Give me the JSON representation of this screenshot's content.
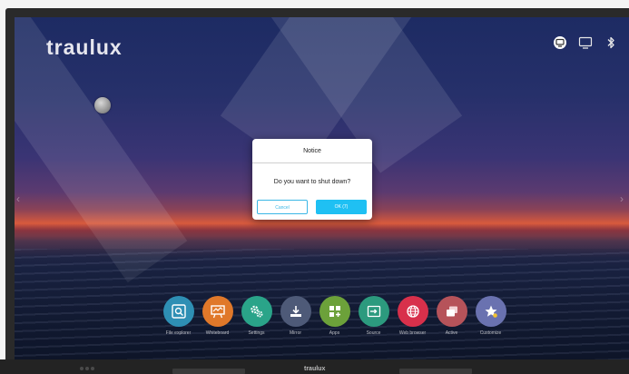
{
  "brand": {
    "logo_text": "traulux"
  },
  "tray": {
    "icons": [
      "screen-cast-icon",
      "monitor-icon",
      "bluetooth-icon"
    ]
  },
  "dialog": {
    "title": "Notice",
    "message": "Do you want to shut down?",
    "cancel_label": "Cancel",
    "ok_label": "OK (7)"
  },
  "dock": {
    "items": [
      {
        "label": "File explorer",
        "icon": "folder-search-icon",
        "color": "#2e8fb4"
      },
      {
        "label": "Whiteboard",
        "icon": "whiteboard-icon",
        "color": "#e0782a"
      },
      {
        "label": "Settings",
        "icon": "gears-icon",
        "color": "#2aa489"
      },
      {
        "label": "Mirror",
        "icon": "download-tray-icon",
        "color": "#4e5a78"
      },
      {
        "label": "Apps",
        "icon": "apps-grid-icon",
        "color": "#6ca13a"
      },
      {
        "label": "Source",
        "icon": "input-source-icon",
        "color": "#2c9a7e"
      },
      {
        "label": "Web browser",
        "icon": "globe-icon",
        "color": "#d8304b"
      },
      {
        "label": "Active",
        "icon": "windows-icon",
        "color": "#b6535a"
      },
      {
        "label": "Customize",
        "icon": "star-icon",
        "color": "#6a72b0"
      }
    ]
  },
  "bottom": {
    "logo_text": "traulux"
  },
  "colors": {
    "accent": "#1fc0f3",
    "bezel": "#2a2a2a"
  }
}
